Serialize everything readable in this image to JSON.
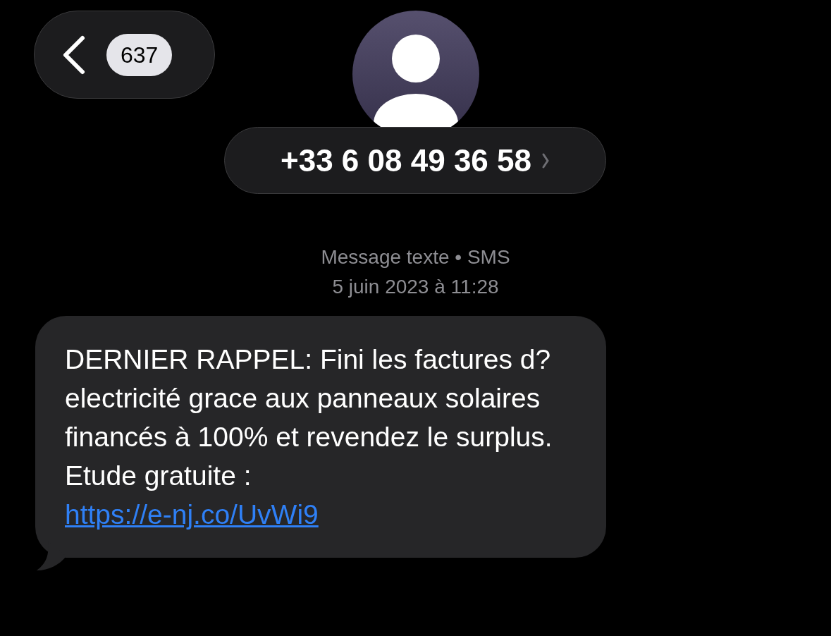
{
  "header": {
    "back_count": "637",
    "contact": "+33 6 08 49 36 58"
  },
  "meta": {
    "service": "Message texte • SMS",
    "timestamp": "5 juin 2023 à 11:28"
  },
  "messages": [
    {
      "text": "DERNIER RAPPEL: Fini les factures d?electricité grace aux panneaux solaires financés à 100% et revendez le surplus. Etude gratuite :",
      "link": "https://e-nj.co/UvWi9"
    }
  ]
}
